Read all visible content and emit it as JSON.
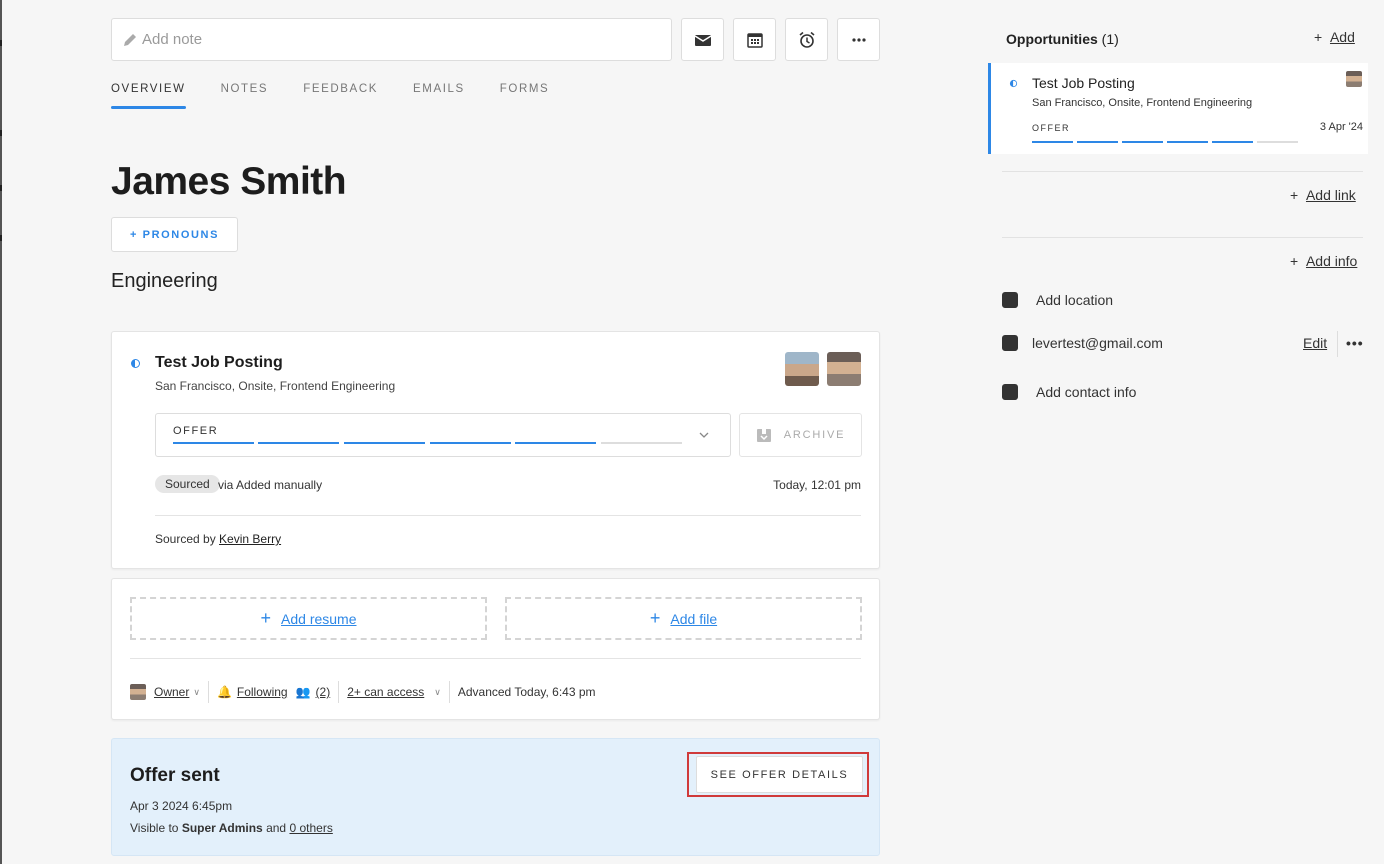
{
  "toolbar": {
    "note_placeholder": "Add note",
    "icons": [
      "email-icon",
      "calendar-icon",
      "alarm-icon",
      "more-icon"
    ]
  },
  "tabs": [
    "OVERVIEW",
    "NOTES",
    "FEEDBACK",
    "EMAILS",
    "FORMS"
  ],
  "candidate": {
    "name": "James Smith",
    "pronouns_button": "+ PRONOUNS",
    "department": "Engineering"
  },
  "opportunity": {
    "title": "Test Job Posting",
    "subtitle": "San Francisco, Onsite, Frontend Engineering",
    "stage": "OFFER",
    "stage_progress": "5 of 6",
    "archive_label": "ARCHIVE",
    "source_badge": "Sourced",
    "source_via": "via Added manually",
    "timestamp": "Today, 12:01 pm",
    "sourced_by_prefix": "Sourced by",
    "sourced_by_name": "Kevin Berry"
  },
  "attachments": {
    "add_resume": "Add resume",
    "add_file": "Add file",
    "owner": "Owner",
    "following": "Following",
    "followers_count": "(2)",
    "access": "2+ can access",
    "advanced": "Advanced Today, 6:43 pm"
  },
  "offer": {
    "title": "Offer sent",
    "date": "Apr 3 2024 6:45pm",
    "visible_prefix": "Visible to",
    "visible_group": "Super Admins",
    "visible_and": "and",
    "visible_others": "0 others",
    "button": "SEE OFFER DETAILS"
  },
  "sidebar": {
    "opportunities_label": "Opportunities",
    "opportunities_count": "(1)",
    "add_label": "Add",
    "card": {
      "title": "Test Job Posting",
      "subtitle": "San Francisco, Onsite, Frontend Engineering",
      "stage": "OFFER",
      "date": "3 Apr '24"
    },
    "add_link": "Add link",
    "add_info": "Add info",
    "add_location": "Add location",
    "email": "levertest@gmail.com",
    "edit": "Edit",
    "more": "•••",
    "add_contact": "Add contact info"
  },
  "colors": {
    "accent": "#2d87e6",
    "offer_bg": "#e3f0fb",
    "highlight": "#d03a3a"
  }
}
